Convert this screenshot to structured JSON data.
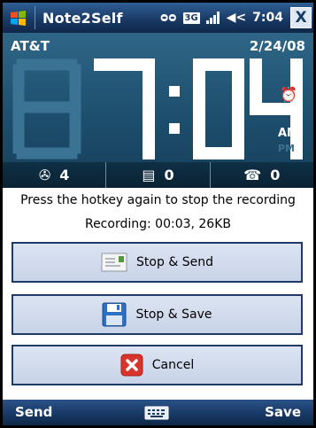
{
  "titlebar": {
    "title": "Note2Self",
    "clock": "7:04",
    "tray_glyph_voicemail": "ᴑᴑ",
    "tray_badge_3g": "3G",
    "tray_speaker": "◀<",
    "close_label": "X"
  },
  "today": {
    "carrier": "AT&T",
    "date": "2/24/08",
    "time": "7:04",
    "am": "AM",
    "pm": "PM",
    "stats": [
      {
        "icon": "voicemail-icon",
        "value": "4"
      },
      {
        "icon": "message-icon",
        "value": "0"
      },
      {
        "icon": "missed-call-icon",
        "value": "0"
      }
    ]
  },
  "dialog": {
    "message": "Press the hotkey again to stop the recording",
    "recording_status": "Recording: 00:03, 26KB",
    "buttons": {
      "stop_send": "Stop & Send",
      "stop_save": "Stop & Save",
      "cancel": "Cancel"
    }
  },
  "softkeys": {
    "left": "Send",
    "right": "Save"
  },
  "colors": {
    "titlebar": "#1a3b66",
    "today_bg": "#1d4e6d",
    "button_bg": "#d3dcee",
    "button_border": "#1f3a66",
    "cancel_icon": "#d9342b"
  }
}
